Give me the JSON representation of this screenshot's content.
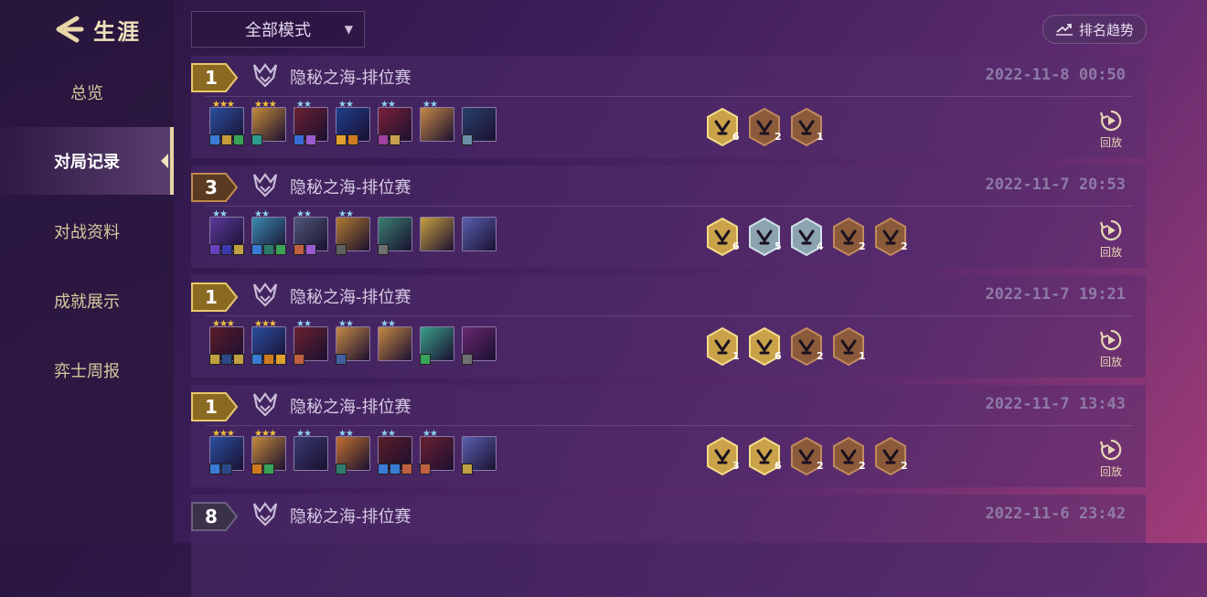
{
  "sidebar": {
    "title": "生涯",
    "items": [
      {
        "label": "总览",
        "active": false
      },
      {
        "label": "对局记录",
        "active": true
      },
      {
        "label": "对战资料",
        "active": false
      },
      {
        "label": "成就展示",
        "active": false
      },
      {
        "label": "弈士周报",
        "active": false
      }
    ]
  },
  "toolbar": {
    "mode_select": "全部模式",
    "trend_button": "排名趋势"
  },
  "replay_label": "回放",
  "colors": {
    "gold": "#c9a24a",
    "bronze": "#8a5a3a",
    "silver": "#8ca3b0"
  },
  "matches": [
    {
      "rank": "1",
      "mode": "隐秘之海-排位赛",
      "date": "2022-11-8 00:50",
      "champions": [
        {
          "stars": "★★★",
          "star_color": "#f2c33c",
          "portrait": "#2a4fa0",
          "items": [
            "#3a7bd5",
            "#c79a3a",
            "#3aa35a"
          ]
        },
        {
          "stars": "★★★",
          "star_color": "#f2c33c",
          "portrait": "#c48a3a",
          "items": [
            "#2f9b8e"
          ]
        },
        {
          "stars": "★★",
          "star_color": "#8fd3f0",
          "portrait": "#6a2030",
          "items": [
            "#3a6bd5",
            "#9b5ad0"
          ]
        },
        {
          "stars": "★★",
          "star_color": "#8fd3f0",
          "portrait": "#1e3e8a",
          "items": [
            "#e0a030",
            "#d07a20"
          ]
        },
        {
          "stars": "★★",
          "star_color": "#8fd3f0",
          "portrait": "#7a2038",
          "items": [
            "#a040a0",
            "#c8a050"
          ]
        },
        {
          "stars": "★★",
          "star_color": "#8fd3f0",
          "portrait": "#c58845",
          "items": []
        },
        {
          "stars": "",
          "star_color": "#8fd3f0",
          "portrait": "#28406a",
          "items": [
            "#6b8fa8"
          ]
        }
      ],
      "traits": [
        {
          "tier": "gold",
          "count": "6"
        },
        {
          "tier": "bronze",
          "count": "2"
        },
        {
          "tier": "bronze",
          "count": "1"
        }
      ]
    },
    {
      "rank": "3",
      "mode": "隐秘之海-排位赛",
      "date": "2022-11-7 20:53",
      "champions": [
        {
          "stars": "★★",
          "star_color": "#8fd3f0",
          "portrait": "#5a3a9a",
          "items": [
            "#6a40c0",
            "#3a3ab0",
            "#c0a040"
          ]
        },
        {
          "stars": "★★",
          "star_color": "#8fd3f0",
          "portrait": "#3a8ab0",
          "items": [
            "#3a7bd5",
            "#2f7a6e",
            "#3aa35a"
          ]
        },
        {
          "stars": "★★",
          "star_color": "#8fd3f0",
          "portrait": "#505878",
          "items": [
            "#c06040",
            "#9b5ad0"
          ]
        },
        {
          "stars": "★★",
          "star_color": "#8fd3f0",
          "portrait": "#b07a30",
          "items": [
            "#606060"
          ]
        },
        {
          "stars": "",
          "star_color": "#8fd3f0",
          "portrait": "#3a8070",
          "items": [
            "#707070"
          ]
        },
        {
          "stars": "",
          "star_color": "#8fd3f0",
          "portrait": "#c8a040",
          "items": []
        },
        {
          "stars": "",
          "star_color": "#8fd3f0",
          "portrait": "#5a60b0",
          "items": []
        }
      ],
      "traits": [
        {
          "tier": "gold",
          "count": "6"
        },
        {
          "tier": "silver",
          "count": "5"
        },
        {
          "tier": "silver",
          "count": "4"
        },
        {
          "tier": "bronze",
          "count": "2"
        },
        {
          "tier": "bronze",
          "count": "2"
        }
      ]
    },
    {
      "rank": "1",
      "mode": "隐秘之海-排位赛",
      "date": "2022-11-7 19:21",
      "champions": [
        {
          "stars": "★★★",
          "star_color": "#f2c33c",
          "portrait": "#5a1c28",
          "items": [
            "#c0a040",
            "#2a4a8a",
            "#c0a040"
          ]
        },
        {
          "stars": "★★★",
          "star_color": "#f2c33c",
          "portrait": "#2a4fa0",
          "items": [
            "#3a7bd5",
            "#d07a20",
            "#e0a030"
          ]
        },
        {
          "stars": "★★",
          "star_color": "#8fd3f0",
          "portrait": "#6a2030",
          "items": [
            "#c06040"
          ]
        },
        {
          "stars": "★★",
          "star_color": "#8fd3f0",
          "portrait": "#c58845",
          "items": [
            "#4060a0"
          ]
        },
        {
          "stars": "★★",
          "star_color": "#8fd3f0",
          "portrait": "#c58845",
          "items": []
        },
        {
          "stars": "",
          "star_color": "#8fd3f0",
          "portrait": "#3aa08a",
          "items": [
            "#3aa35a"
          ]
        },
        {
          "stars": "",
          "star_color": "#8fd3f0",
          "portrait": "#6a2870",
          "items": [
            "#707070"
          ]
        }
      ],
      "traits": [
        {
          "tier": "gold",
          "count": "1"
        },
        {
          "tier": "gold",
          "count": "6"
        },
        {
          "tier": "bronze",
          "count": "2"
        },
        {
          "tier": "bronze",
          "count": "1"
        }
      ]
    },
    {
      "rank": "1",
      "mode": "隐秘之海-排位赛",
      "date": "2022-11-7 13:43",
      "champions": [
        {
          "stars": "★★★",
          "star_color": "#f2c33c",
          "portrait": "#2a4fa0",
          "items": [
            "#3a7bd5",
            "#2a4a8a"
          ]
        },
        {
          "stars": "★★★",
          "star_color": "#f2c33c",
          "portrait": "#c48a3a",
          "items": [
            "#d07a20",
            "#3aa35a"
          ]
        },
        {
          "stars": "★★",
          "star_color": "#8fd3f0",
          "portrait": "#3a3a70",
          "items": []
        },
        {
          "stars": "★★",
          "star_color": "#8fd3f0",
          "portrait": "#c07030",
          "items": [
            "#2f7a6e"
          ]
        },
        {
          "stars": "★★",
          "star_color": "#8fd3f0",
          "portrait": "#5a1c28",
          "items": [
            "#3a7bd5",
            "#3a7bd5",
            "#c06040"
          ]
        },
        {
          "stars": "★★",
          "star_color": "#8fd3f0",
          "portrait": "#6a2030",
          "items": [
            "#c06040"
          ]
        },
        {
          "stars": "",
          "star_color": "#8fd3f0",
          "portrait": "#5a60b0",
          "items": [
            "#c0a040"
          ]
        }
      ],
      "traits": [
        {
          "tier": "gold",
          "count": "3"
        },
        {
          "tier": "gold",
          "count": "6"
        },
        {
          "tier": "bronze",
          "count": "2"
        },
        {
          "tier": "bronze",
          "count": "2"
        },
        {
          "tier": "bronze",
          "count": "2"
        }
      ]
    },
    {
      "rank": "8",
      "mode": "隐秘之海-排位赛",
      "date": "2022-11-6 23:42",
      "champions": [],
      "traits": []
    }
  ]
}
